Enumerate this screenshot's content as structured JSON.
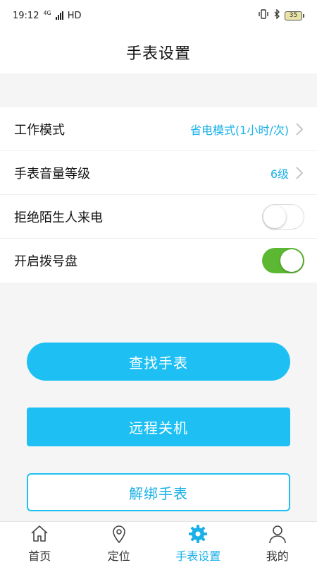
{
  "status_bar": {
    "time": "19:12",
    "network": "4G",
    "hd": "HD",
    "battery": "35"
  },
  "header": {
    "title": "手表设置"
  },
  "settings": {
    "work_mode": {
      "label": "工作模式",
      "value": "省电模式(1小时/次)"
    },
    "volume": {
      "label": "手表音量等级",
      "value": "6级"
    },
    "reject_strangers": {
      "label": "拒绝陌生人来电",
      "enabled": false
    },
    "dial_pad": {
      "label": "开启拨号盘",
      "enabled": true
    }
  },
  "buttons": {
    "find_watch": "查找手表",
    "remote_shutdown": "远程关机",
    "unbind_watch": "解绑手表"
  },
  "tabs": [
    {
      "label": "首页",
      "icon": "home-icon"
    },
    {
      "label": "定位",
      "icon": "location-pin-icon"
    },
    {
      "label": "手表设置",
      "icon": "gear-icon",
      "active": true
    },
    {
      "label": "我的",
      "icon": "person-icon"
    }
  ],
  "colors": {
    "accent": "#1ec0f4",
    "toggle_on": "#5cb832"
  }
}
